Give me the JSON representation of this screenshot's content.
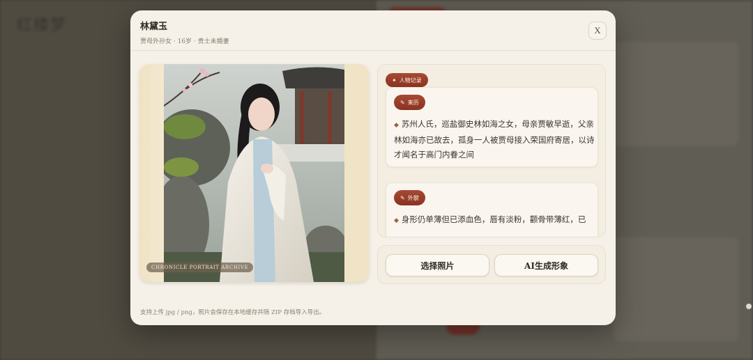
{
  "background": {
    "title": "红楼梦"
  },
  "modal": {
    "name": "林黛玉",
    "subtitle": "贾母外孙女 · 16岁 · 贵士未婚妻",
    "close_label": "X",
    "photo_caption": "CHRONICLE PORTRAIT ARCHIVE",
    "record_tag": "人物记录",
    "sections": [
      {
        "chip": "来历",
        "text": "苏州人氏，巡盐御史林如海之女，母亲贾敏早逝，父亲林如海亦已故去，孤身一人被贾母接入荣国府寄居，以诗才闻名于高门内眷之间"
      },
      {
        "chip": "外貌",
        "text": "身形仍单薄但已添血色，唇有淡粉，颧骨带薄红，已"
      }
    ],
    "buttons": {
      "select_photo": "选择照片",
      "ai_generate": "AI生成形象"
    },
    "footer_note": "支持上传 jpg / png，照片会保存在本地缓存并随 ZIP 存档导入导出。"
  },
  "colors": {
    "accent": "#9a3f2b",
    "modal_bg": "#f6f1e8"
  },
  "icons": {
    "record": "sparkle-icon",
    "section": "pencil-icon"
  }
}
